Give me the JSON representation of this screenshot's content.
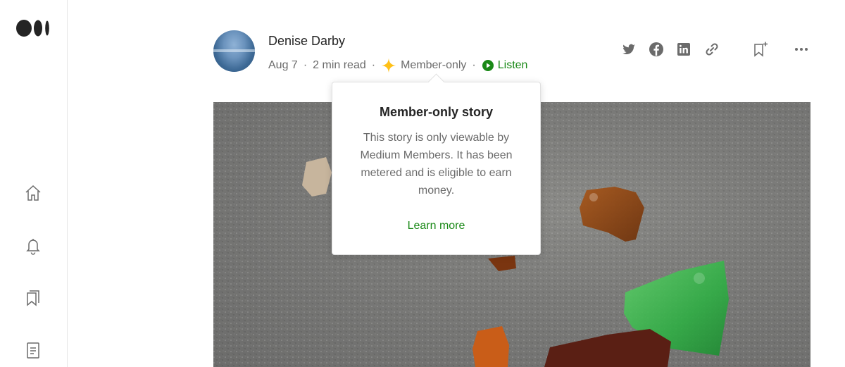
{
  "author": {
    "name": "Denise Darby",
    "date": "Aug 7",
    "read_time": "2 min read",
    "member_label": "Member-only",
    "listen_label": "Listen"
  },
  "popover": {
    "title": "Member-only story",
    "body": "This story is only viewable by Medium Members. It has been metered and is eligible to earn money.",
    "link": "Learn more"
  },
  "icons": {
    "rail": [
      "home-icon",
      "bell-icon",
      "bookmarks-icon",
      "stories-icon"
    ],
    "actions": [
      "twitter-icon",
      "facebook-icon",
      "linkedin-icon",
      "link-icon",
      "bookmark-add-icon",
      "more-icon"
    ]
  },
  "colors": {
    "accent_green": "#1a8917",
    "star_gold": "#ffc017",
    "muted_text": "#6b6b6b",
    "icon_gray": "#6b6b6b"
  }
}
